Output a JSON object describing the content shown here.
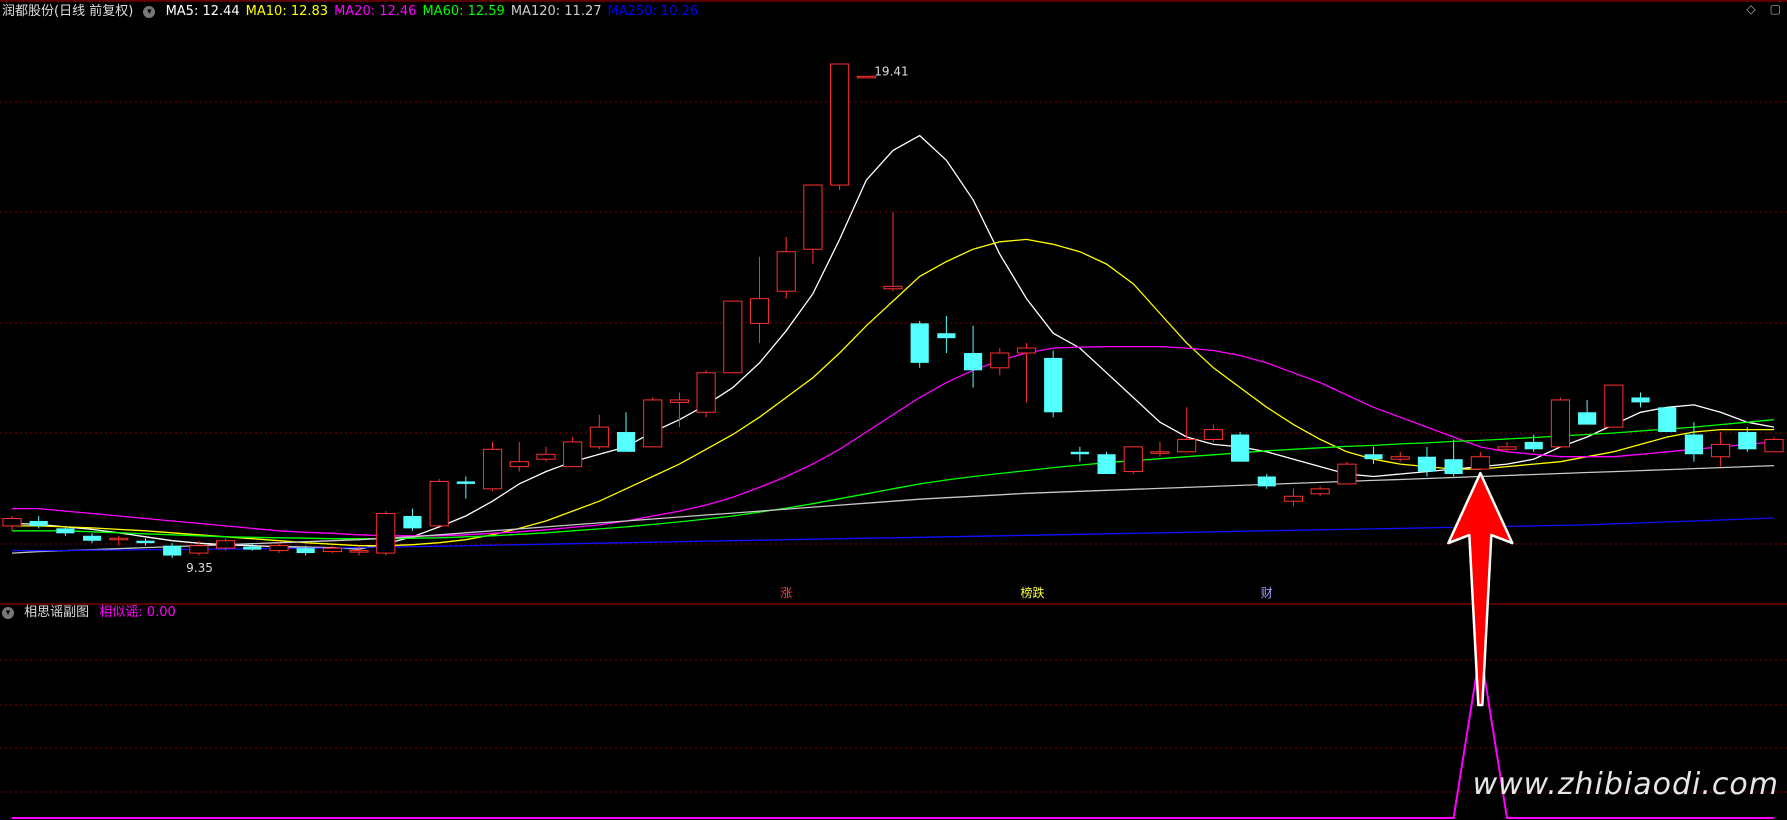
{
  "header": {
    "title": "润都股份(日线 前复权)",
    "indicators": [
      {
        "label": "MA5: 12.44",
        "color": "#ffffff"
      },
      {
        "label": "MA10: 12.83",
        "color": "#ffff00"
      },
      {
        "label": "MA20: 12.46",
        "color": "#ff00ff"
      },
      {
        "label": "MA60: 12.59",
        "color": "#00ff00"
      },
      {
        "label": "MA120: 11.27",
        "color": "#cccccc"
      },
      {
        "label": "MA250: 10.26",
        "color": "#0000ff"
      }
    ]
  },
  "sub_header": {
    "title": "相思谣副图",
    "indicator": {
      "label": "相似谣: 0.00",
      "color": "#ff00ff"
    }
  },
  "markers": [
    {
      "label": "涨",
      "color": "#ff4040",
      "index": 29
    },
    {
      "label": "榜跌",
      "color": "#ffff40",
      "index": 38
    },
    {
      "label": "财",
      "color": "#a0a0ff",
      "index": 47
    }
  ],
  "watermark": "www.zhibiaodi.com",
  "colors": {
    "up": "#ff3030",
    "down": "#54ffff",
    "grid": "#800000",
    "arrow": "#ff0000"
  },
  "chart_data": {
    "type": "candlestick",
    "price_range": [
      8.5,
      20.2
    ],
    "max_label": "19.41",
    "min_label": "9.35",
    "arrow_index": 55,
    "signal_index": 55,
    "ohlc": [
      [
        10.0,
        10.2,
        9.9,
        10.15
      ],
      [
        10.1,
        10.2,
        9.95,
        10.0
      ],
      [
        9.95,
        10.0,
        9.8,
        9.85
      ],
      [
        9.8,
        9.85,
        9.65,
        9.7
      ],
      [
        9.72,
        9.8,
        9.6,
        9.75
      ],
      [
        9.7,
        9.75,
        9.6,
        9.65
      ],
      [
        9.6,
        9.65,
        9.35,
        9.4
      ],
      [
        9.45,
        9.7,
        9.4,
        9.6
      ],
      [
        9.55,
        9.75,
        9.5,
        9.7
      ],
      [
        9.58,
        9.65,
        9.5,
        9.52
      ],
      [
        9.5,
        9.7,
        9.45,
        9.6
      ],
      [
        9.55,
        9.6,
        9.4,
        9.45
      ],
      [
        9.48,
        9.6,
        9.45,
        9.55
      ],
      [
        9.5,
        9.6,
        9.4,
        9.5
      ],
      [
        9.45,
        10.3,
        9.4,
        10.25
      ],
      [
        10.2,
        10.35,
        9.9,
        9.95
      ],
      [
        10.0,
        10.95,
        10.0,
        10.9
      ],
      [
        10.9,
        11.0,
        10.55,
        10.85
      ],
      [
        10.75,
        11.7,
        10.7,
        11.55
      ],
      [
        11.2,
        11.7,
        11.1,
        11.3
      ],
      [
        11.35,
        11.6,
        11.3,
        11.45
      ],
      [
        11.2,
        11.8,
        11.2,
        11.7
      ],
      [
        11.6,
        12.25,
        11.55,
        12.0
      ],
      [
        11.9,
        12.3,
        11.5,
        11.5
      ],
      [
        11.6,
        12.6,
        11.6,
        12.55
      ],
      [
        12.5,
        12.7,
        12.0,
        12.55
      ],
      [
        12.3,
        13.15,
        12.2,
        13.1
      ],
      [
        13.1,
        14.55,
        13.1,
        14.55
      ],
      [
        14.1,
        15.45,
        13.7,
        14.6
      ],
      [
        14.75,
        15.85,
        14.6,
        15.55
      ],
      [
        15.6,
        16.9,
        15.3,
        16.9
      ],
      [
        16.9,
        18.8,
        16.8,
        19.35
      ],
      [
        19.1,
        19.1,
        19.1,
        19.1
      ],
      [
        14.8,
        16.35,
        14.75,
        14.85
      ],
      [
        14.1,
        14.15,
        13.2,
        13.3
      ],
      [
        13.9,
        14.25,
        13.5,
        13.8
      ],
      [
        13.5,
        14.05,
        12.8,
        13.15
      ],
      [
        13.2,
        13.6,
        13.05,
        13.5
      ],
      [
        13.5,
        13.7,
        12.5,
        13.6
      ],
      [
        13.4,
        13.55,
        12.2,
        12.3
      ],
      [
        11.5,
        11.6,
        11.3,
        11.45
      ],
      [
        11.45,
        11.5,
        11.05,
        11.05
      ],
      [
        11.1,
        11.6,
        11.05,
        11.6
      ],
      [
        11.5,
        11.7,
        11.4,
        11.5
      ],
      [
        11.5,
        12.4,
        11.5,
        11.75
      ],
      [
        11.75,
        12.05,
        11.7,
        11.95
      ],
      [
        11.85,
        11.9,
        11.3,
        11.3
      ],
      [
        11.0,
        11.05,
        10.75,
        10.8
      ],
      [
        10.5,
        10.75,
        10.4,
        10.6
      ],
      [
        10.65,
        10.8,
        10.6,
        10.75
      ],
      [
        10.85,
        11.3,
        10.85,
        11.25
      ],
      [
        11.45,
        11.6,
        11.25,
        11.35
      ],
      [
        11.35,
        11.5,
        11.3,
        11.4
      ],
      [
        11.4,
        11.6,
        11.0,
        11.1
      ],
      [
        11.35,
        11.75,
        11.0,
        11.05
      ],
      [
        11.15,
        11.5,
        11.15,
        11.4
      ],
      [
        11.55,
        11.7,
        11.5,
        11.6
      ],
      [
        11.7,
        11.85,
        11.5,
        11.55
      ],
      [
        11.6,
        12.6,
        11.7,
        12.55
      ],
      [
        12.3,
        12.55,
        12.1,
        12.05
      ],
      [
        12.0,
        12.85,
        12.0,
        12.85
      ],
      [
        12.6,
        12.7,
        12.4,
        12.5
      ],
      [
        12.4,
        12.2,
        11.9,
        11.9
      ],
      [
        11.85,
        12.1,
        11.3,
        11.45
      ],
      [
        11.4,
        11.9,
        11.2,
        11.65
      ],
      [
        11.9,
        12.0,
        11.5,
        11.55
      ],
      [
        11.5,
        11.8,
        11.5,
        11.75
      ]
    ],
    "ma": [
      {
        "name": "MA5",
        "color": "#ffffff",
        "values": [
          10.05,
          10.03,
          9.98,
          9.93,
          9.86,
          9.78,
          9.7,
          9.65,
          9.62,
          9.6,
          9.58,
          9.57,
          9.56,
          9.53,
          9.64,
          9.78,
          9.98,
          10.2,
          10.5,
          10.85,
          11.1,
          11.3,
          11.45,
          11.6,
          11.9,
          12.15,
          12.45,
          12.8,
          13.3,
          13.95,
          14.7,
          15.8,
          17.0,
          17.6,
          17.9,
          17.4,
          16.6,
          15.5,
          14.6,
          13.9,
          13.6,
          13.1,
          12.6,
          12.1,
          11.8,
          11.65,
          11.6,
          11.5,
          11.35,
          11.2,
          11.05,
          11.0,
          11.05,
          11.1,
          11.15,
          11.2,
          11.25,
          11.35,
          11.6,
          11.8,
          12.05,
          12.3,
          12.4,
          12.45,
          12.3,
          12.1,
          12.0
        ]
      },
      {
        "name": "MA10",
        "color": "#ffff00",
        "values": [
          10.0,
          10.0,
          9.98,
          9.96,
          9.93,
          9.9,
          9.86,
          9.82,
          9.78,
          9.74,
          9.7,
          9.66,
          9.63,
          9.6,
          9.6,
          9.62,
          9.66,
          9.72,
          9.82,
          9.95,
          10.1,
          10.3,
          10.5,
          10.75,
          11.0,
          11.25,
          11.55,
          11.85,
          12.2,
          12.6,
          13.0,
          13.5,
          14.05,
          14.55,
          15.05,
          15.35,
          15.6,
          15.75,
          15.8,
          15.7,
          15.55,
          15.3,
          14.9,
          14.3,
          13.7,
          13.2,
          12.8,
          12.4,
          12.05,
          11.75,
          11.5,
          11.35,
          11.25,
          11.2,
          11.15,
          11.15,
          11.2,
          11.25,
          11.3,
          11.4,
          11.5,
          11.65,
          11.8,
          11.9,
          11.95,
          11.95,
          11.95
        ]
      },
      {
        "name": "MA20",
        "color": "#ff00ff",
        "values": [
          10.35,
          10.35,
          10.3,
          10.25,
          10.2,
          10.15,
          10.1,
          10.05,
          10.0,
          9.95,
          9.9,
          9.87,
          9.85,
          9.82,
          9.8,
          9.8,
          9.8,
          9.82,
          9.85,
          9.88,
          9.92,
          9.97,
          10.02,
          10.1,
          10.2,
          10.3,
          10.42,
          10.58,
          10.78,
          11.0,
          11.25,
          11.55,
          11.9,
          12.25,
          12.6,
          12.9,
          13.15,
          13.35,
          13.5,
          13.6,
          13.62,
          13.63,
          13.63,
          13.63,
          13.6,
          13.55,
          13.45,
          13.3,
          13.1,
          12.9,
          12.65,
          12.4,
          12.2,
          12.0,
          11.8,
          11.6,
          11.5,
          11.45,
          11.4,
          11.4,
          11.4,
          11.45,
          11.5,
          11.55,
          11.6,
          11.65,
          11.7
        ]
      },
      {
        "name": "MA60",
        "color": "#00ff00",
        "values": [
          9.9,
          9.9,
          9.9,
          9.88,
          9.86,
          9.84,
          9.82,
          9.8,
          9.78,
          9.77,
          9.76,
          9.75,
          9.74,
          9.74,
          9.74,
          9.75,
          9.76,
          9.78,
          9.8,
          9.83,
          9.86,
          9.9,
          9.94,
          9.98,
          10.03,
          10.08,
          10.14,
          10.2,
          10.28,
          10.36,
          10.45,
          10.55,
          10.65,
          10.75,
          10.85,
          10.93,
          11.0,
          11.06,
          11.12,
          11.18,
          11.23,
          11.28,
          11.32,
          11.36,
          11.4,
          11.44,
          11.48,
          11.52,
          11.55,
          11.58,
          11.61,
          11.63,
          11.66,
          11.68,
          11.71,
          11.73,
          11.76,
          11.79,
          11.82,
          11.85,
          11.88,
          11.92,
          11.96,
          12.0,
          12.05,
          12.1,
          12.15
        ]
      },
      {
        "name": "MA120",
        "color": "#c8c8c8",
        "values": [
          9.45,
          9.48,
          9.5,
          9.52,
          9.54,
          9.56,
          9.58,
          9.6,
          9.62,
          9.64,
          9.66,
          9.68,
          9.7,
          9.72,
          9.75,
          9.78,
          9.82,
          9.86,
          9.9,
          9.94,
          9.98,
          10.02,
          10.06,
          10.1,
          10.14,
          10.18,
          10.22,
          10.26,
          10.3,
          10.34,
          10.38,
          10.42,
          10.46,
          10.5,
          10.54,
          10.57,
          10.6,
          10.63,
          10.66,
          10.68,
          10.7,
          10.72,
          10.74,
          10.76,
          10.78,
          10.8,
          10.82,
          10.84,
          10.86,
          10.88,
          10.9,
          10.92,
          10.94,
          10.96,
          10.98,
          11.0,
          11.02,
          11.04,
          11.06,
          11.08,
          11.1,
          11.12,
          11.14,
          11.16,
          11.18,
          11.2,
          11.22
        ]
      },
      {
        "name": "MA250",
        "color": "#1010ff",
        "values": [
          9.5,
          9.5,
          9.5,
          9.51,
          9.51,
          9.52,
          9.52,
          9.53,
          9.53,
          9.54,
          9.54,
          9.55,
          9.55,
          9.56,
          9.57,
          9.58,
          9.59,
          9.6,
          9.61,
          9.62,
          9.63,
          9.64,
          9.65,
          9.66,
          9.67,
          9.68,
          9.69,
          9.7,
          9.71,
          9.72,
          9.73,
          9.74,
          9.75,
          9.76,
          9.77,
          9.78,
          9.79,
          9.8,
          9.81,
          9.82,
          9.83,
          9.84,
          9.85,
          9.86,
          9.87,
          9.88,
          9.89,
          9.9,
          9.91,
          9.92,
          9.93,
          9.94,
          9.95,
          9.96,
          9.97,
          9.98,
          9.99,
          10.0,
          10.01,
          10.02,
          10.04,
          10.06,
          10.08,
          10.1,
          10.12,
          10.14,
          10.16
        ]
      }
    ],
    "sub_range": [
      0,
      1
    ],
    "signal_values": [
      0,
      0,
      0,
      0,
      0,
      0,
      0,
      0,
      0,
      0,
      0,
      0,
      0,
      0,
      0,
      0,
      0,
      0,
      0,
      0,
      0,
      0,
      0,
      0,
      0,
      0,
      0,
      0,
      0,
      0,
      0,
      0,
      0,
      0,
      0,
      0,
      0,
      0,
      0,
      0,
      0,
      0,
      0,
      0,
      0,
      0,
      0,
      0,
      0,
      0,
      0,
      0,
      0,
      0,
      0,
      1,
      0,
      0,
      0,
      0,
      0,
      0,
      0,
      0,
      0,
      0,
      0
    ]
  }
}
